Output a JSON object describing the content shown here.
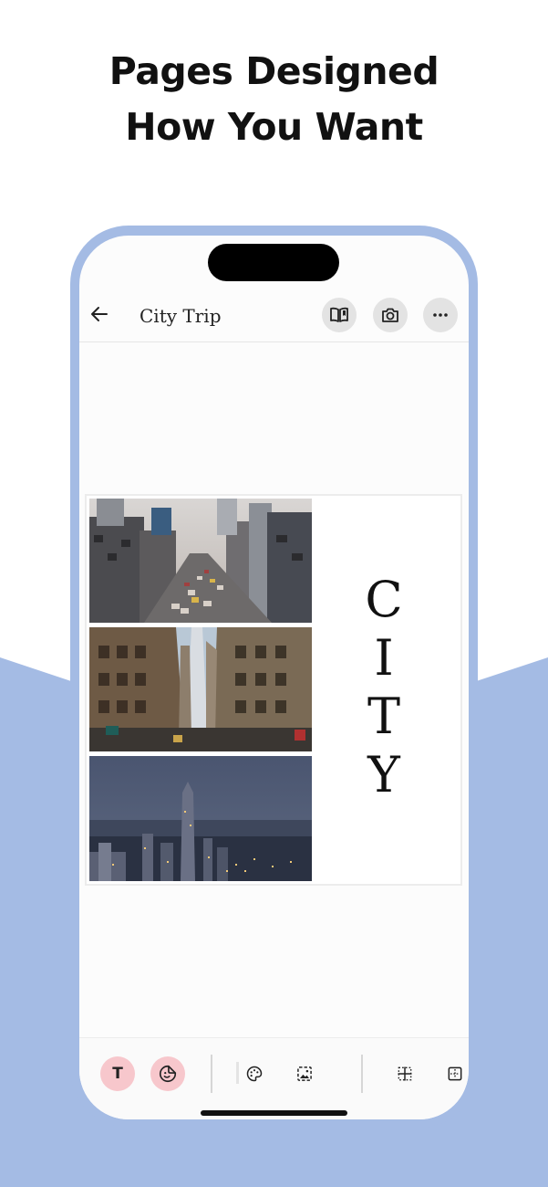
{
  "headline": {
    "line1": "Pages Designed",
    "line2": "How You Want"
  },
  "colors": {
    "accent_blue": "#a4bbe4",
    "pink": "#f7c7cc"
  },
  "app": {
    "title": "City Trip",
    "icons": {
      "back": "arrow-left-icon",
      "book": "open-book-icon",
      "camera": "camera-icon",
      "more": "more-dots-icon"
    }
  },
  "page": {
    "photos": [
      "city-street-traffic-photo",
      "skyscraper-street-photo",
      "city-night-skyline-photo"
    ],
    "word_letters": [
      "C",
      "I",
      "T",
      "Y"
    ]
  },
  "toolbar": {
    "text_tool": "T",
    "icons": [
      "text-tool-icon",
      "sticker-icon",
      "palette-icon",
      "image-icon",
      "grid-layout-icon",
      "frame-layout-icon"
    ]
  }
}
